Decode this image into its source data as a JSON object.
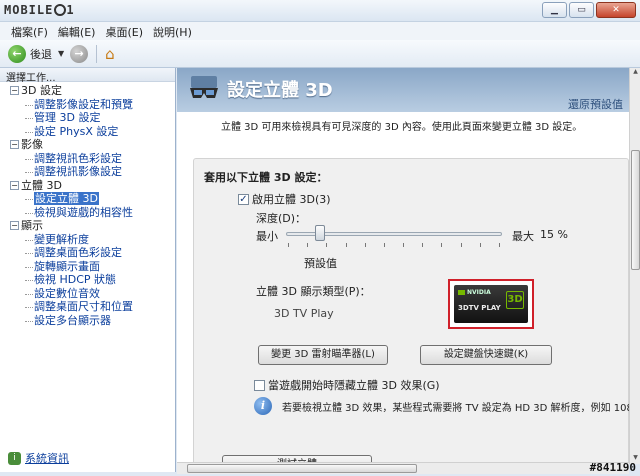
{
  "window": {
    "logo_text": "MOBILE",
    "logo_suffix": "1"
  },
  "menu": [
    "檔案(F)",
    "編輯(E)",
    "桌面(E)",
    "說明(H)"
  ],
  "toolbar": {
    "back_label": "後退"
  },
  "sidebar": {
    "header": "選擇工作...",
    "sections": [
      {
        "label": "3D 設定",
        "items": [
          "調整影像設定和預覽",
          "管理 3D 設定",
          "設定 PhysX 設定"
        ]
      },
      {
        "label": "影像",
        "items": [
          "調整視訊色彩設定",
          "調整視訊影像設定"
        ]
      },
      {
        "label": "立體 3D",
        "items": [
          "設定立體 3D",
          "檢視與遊戲的相容性"
        ]
      },
      {
        "label": "顯示",
        "items": [
          "變更解析度",
          "調整桌面色彩設定",
          "旋轉顯示畫面",
          "檢視 HDCP 狀態",
          "設定數位音效",
          "調整桌面尺寸和位置",
          "設定多台顯示器"
        ]
      }
    ],
    "footer_link": "系統資訊"
  },
  "page": {
    "title": "設定立體 3D",
    "restore_label": "還原預設值",
    "description": "立體 3D 可用來檢視具有可見深度的 3D 內容。使用此頁面來變更立體 3D 設定。",
    "section_title": "套用以下立體 3D 設定：",
    "enable_label": "啟用立體 3D(3)",
    "depth_label": "深度(D)：",
    "min_label": "最小",
    "max_label": "最大",
    "depth_value": "15 %",
    "default_label": "預設值",
    "display_type_label": "立體 3D 顯示類型(P)：",
    "display_type_value": "3D TV Play",
    "badge": {
      "brand": "NVIDIA",
      "product": "3DTV PLAY",
      "mark": "3D"
    },
    "change_emitter_button": "變更 3D 雷射瞄準器(L)",
    "hotkeys_button": "設定鍵盤快速鍵(K)",
    "hide_label": "當遊戲開始時隱藏立體 3D 效果(G)",
    "note_text": "若要檢視立體 3D 效果，某些程式需要將 TV 設定為 HD 3D 解析度，例如 1080",
    "next_button": "測試立體"
  },
  "watermark": "#841190"
}
